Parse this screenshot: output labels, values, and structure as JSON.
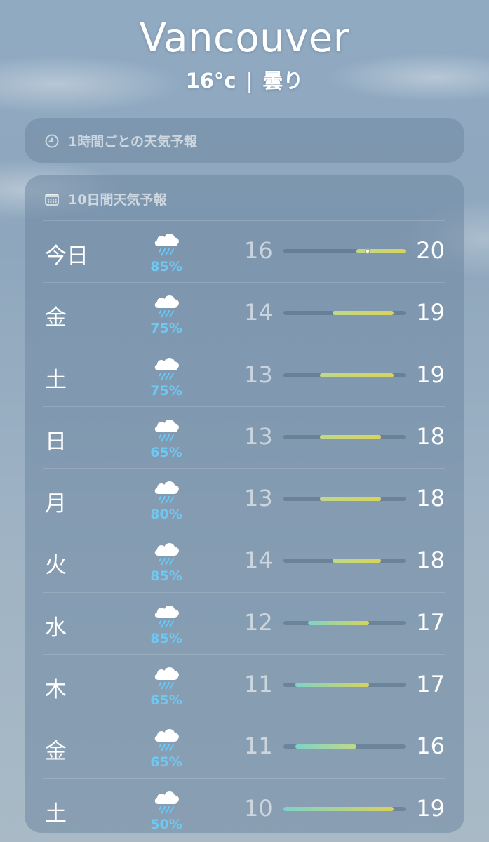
{
  "location": {
    "city": "Vancouver",
    "temperature": "16°c",
    "separator": "|",
    "condition": "曇り"
  },
  "hourly": {
    "title": "1時間ごとの天気予報",
    "icon": "clock-icon"
  },
  "daily": {
    "title": "10日間天気予報",
    "icon": "calendar-icon",
    "range_min": 10,
    "range_max": 20,
    "colors": {
      "cool": "#7ed3c8",
      "mid": "#bfd98a",
      "warm": "#d8d35a"
    },
    "days": [
      {
        "day": "今日",
        "icon": "cloud-rain-icon",
        "chance": "85%",
        "low": "16",
        "high": "20",
        "lo": 16,
        "hi": 20,
        "current": 16.9
      },
      {
        "day": "金",
        "icon": "cloud-rain-icon",
        "chance": "75%",
        "low": "14",
        "high": "19",
        "lo": 14,
        "hi": 19
      },
      {
        "day": "土",
        "icon": "cloud-rain-icon",
        "chance": "75%",
        "low": "13",
        "high": "19",
        "lo": 13,
        "hi": 19
      },
      {
        "day": "日",
        "icon": "cloud-rain-icon",
        "chance": "65%",
        "low": "13",
        "high": "18",
        "lo": 13,
        "hi": 18
      },
      {
        "day": "月",
        "icon": "cloud-rain-icon",
        "chance": "80%",
        "low": "13",
        "high": "18",
        "lo": 13,
        "hi": 18
      },
      {
        "day": "火",
        "icon": "cloud-rain-icon",
        "chance": "85%",
        "low": "14",
        "high": "18",
        "lo": 14,
        "hi": 18
      },
      {
        "day": "水",
        "icon": "cloud-rain-icon",
        "chance": "85%",
        "low": "12",
        "high": "17",
        "lo": 12,
        "hi": 17
      },
      {
        "day": "木",
        "icon": "cloud-rain-icon",
        "chance": "65%",
        "low": "11",
        "high": "17",
        "lo": 11,
        "hi": 17
      },
      {
        "day": "金",
        "icon": "cloud-rain-icon",
        "chance": "65%",
        "low": "11",
        "high": "16",
        "lo": 11,
        "hi": 16
      },
      {
        "day": "土",
        "icon": "cloud-rain-icon",
        "chance": "50%",
        "low": "10",
        "high": "19",
        "lo": 10,
        "hi": 19
      }
    ]
  }
}
